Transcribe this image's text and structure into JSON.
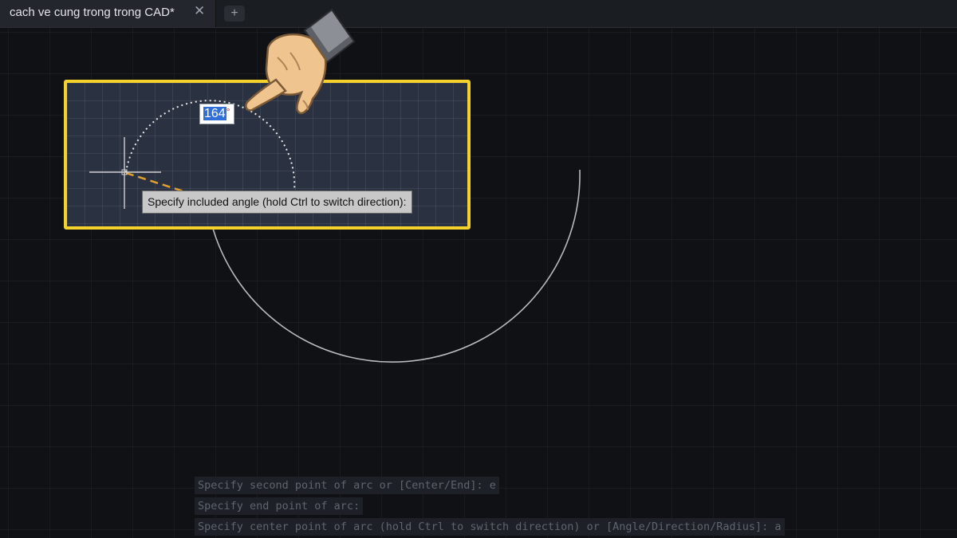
{
  "tabs": [
    {
      "label": "cach ve cung trong trong CAD*",
      "close_symbol": "✕"
    }
  ],
  "new_tab_symbol": "+",
  "inset": {
    "angle_input": {
      "value": "164",
      "unit": "°"
    },
    "tooltip": "Specify included angle (hold Ctrl to switch direction):"
  },
  "command_history": [
    "Specify second point of arc or [Center/End]: e",
    "Specify end point of arc:",
    "Specify center point of arc (hold Ctrl to switch direction) or [Angle/Direction/Radius]: a"
  ],
  "colors": {
    "highlight_border": "#f4d22b",
    "rubber_band": "#e0a030",
    "arc_preview": "#d8d8d8",
    "input_selection": "#2f6fd6"
  },
  "icons": {
    "tab_close": "close-icon",
    "tab_new": "plus-icon",
    "pointer": "pointing-hand-icon",
    "crosshair": "crosshair-cursor-icon"
  }
}
